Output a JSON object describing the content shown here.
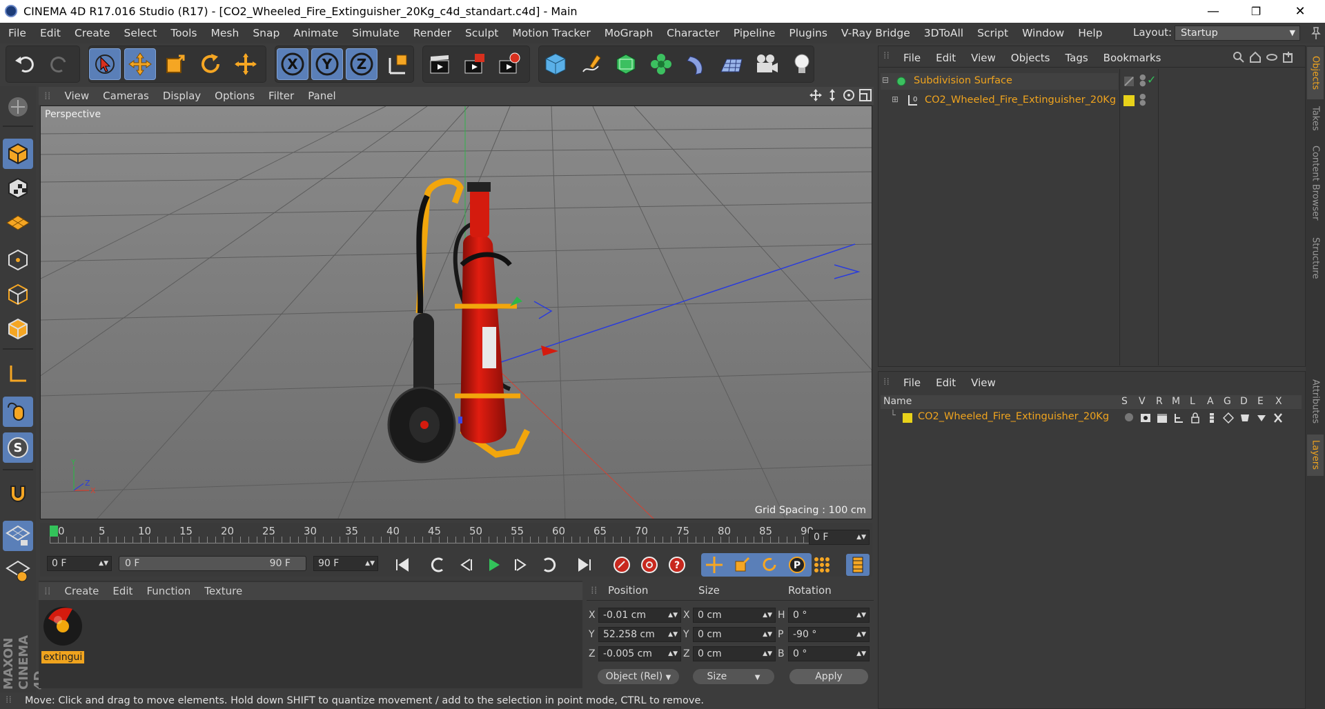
{
  "window": {
    "title": "CINEMA 4D R17.016 Studio (R17) - [CO2_Wheeled_Fire_Extinguisher_20Kg_c4d_standart.c4d] - Main",
    "minimize": "—",
    "maximize": "❐",
    "close": "✕"
  },
  "menubar": {
    "items": [
      "File",
      "Edit",
      "Create",
      "Select",
      "Tools",
      "Mesh",
      "Snap",
      "Animate",
      "Simulate",
      "Render",
      "Sculpt",
      "Motion Tracker",
      "MoGraph",
      "Character",
      "Pipeline",
      "Plugins",
      "V-Ray Bridge",
      "3DToAll",
      "Script",
      "Window",
      "Help"
    ],
    "layout_label": "Layout:",
    "layout_value": "Startup"
  },
  "viewport": {
    "menu": [
      "View",
      "Cameras",
      "Display",
      "Options",
      "Filter",
      "Panel"
    ],
    "label": "Perspective",
    "grid_spacing": "Grid Spacing : 100 cm"
  },
  "timeline": {
    "ticks": [
      "0",
      "5",
      "10",
      "15",
      "20",
      "25",
      "30",
      "35",
      "40",
      "45",
      "50",
      "55",
      "60",
      "65",
      "70",
      "75",
      "80",
      "85",
      "90"
    ],
    "current_frame": "0 F",
    "start_frame": "0 F",
    "range_start": "0 F",
    "range_end": "90 F",
    "end_frame": "90 F"
  },
  "materials": {
    "menu": [
      "Create",
      "Edit",
      "Function",
      "Texture"
    ],
    "items": [
      {
        "name": "extingui"
      }
    ]
  },
  "attributes": {
    "headers": {
      "position": "Position",
      "size": "Size",
      "rotation": "Rotation"
    },
    "rows": [
      {
        "pos_axis": "X",
        "pos": "-0.01 cm",
        "size_axis": "X",
        "size": "0 cm",
        "rot_axis": "H",
        "rot": "0 °"
      },
      {
        "pos_axis": "Y",
        "pos": "52.258 cm",
        "size_axis": "Y",
        "size": "0 cm",
        "rot_axis": "P",
        "rot": "-90 °"
      },
      {
        "pos_axis": "Z",
        "pos": "-0.005 cm",
        "size_axis": "Z",
        "size": "0 cm",
        "rot_axis": "B",
        "rot": "0 °"
      }
    ],
    "mode": "Object (Rel)",
    "size_mode": "Size",
    "apply": "Apply"
  },
  "status": "Move: Click and drag to move elements. Hold down SHIFT to quantize movement / add to the selection in point mode, CTRL to remove.",
  "object_manager": {
    "menu": [
      "File",
      "Edit",
      "View",
      "Objects",
      "Tags",
      "Bookmarks"
    ],
    "objects": [
      {
        "name": "Subdivision Surface"
      },
      {
        "name": "CO2_Wheeled_Fire_Extinguisher_20Kg"
      }
    ]
  },
  "layer_manager": {
    "menu": [
      "File",
      "Edit",
      "View"
    ],
    "columns": [
      "Name",
      "S",
      "V",
      "R",
      "M",
      "L",
      "A",
      "G",
      "D",
      "E",
      "X"
    ],
    "layers": [
      {
        "name": "CO2_Wheeled_Fire_Extinguisher_20Kg"
      }
    ]
  },
  "right_tabs": [
    "Objects",
    "Takes",
    "Content Browser",
    "Structure",
    "Attributes",
    "Layers"
  ],
  "branding": "MAXON CINEMA 4D",
  "colors": {
    "accent_orange": "#f0a41e",
    "selected_blue": "#5a7fb8",
    "bg": "#3c3c3c",
    "viewport": "#767676",
    "layer_yellow": "#e8d21a"
  }
}
